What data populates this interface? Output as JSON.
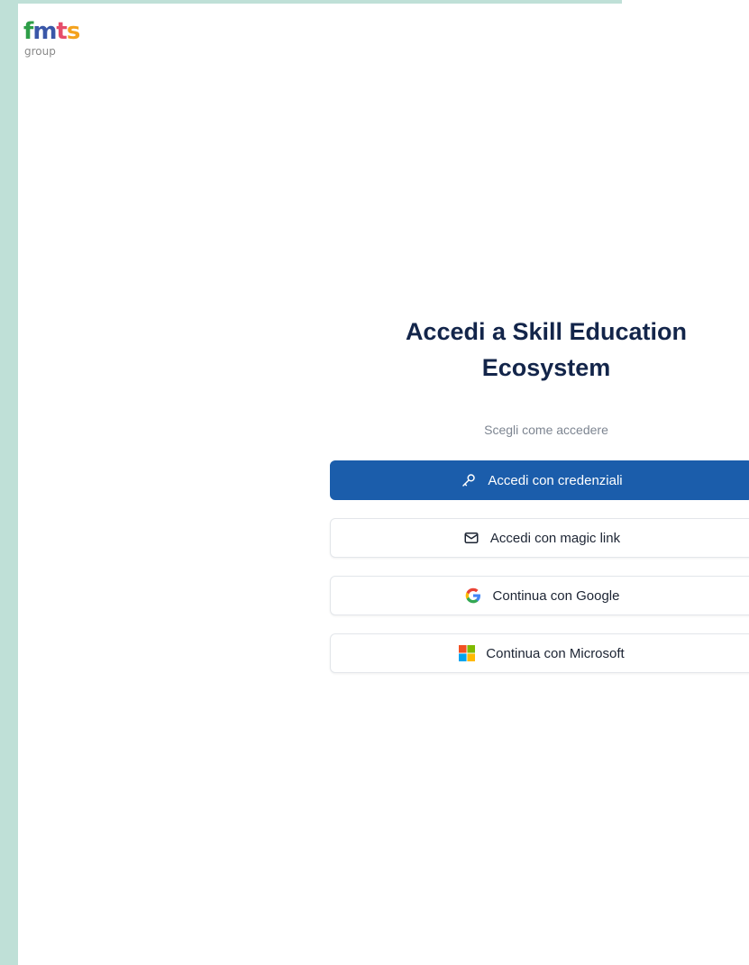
{
  "logo": {
    "letters": [
      "f",
      "m",
      "t",
      "s"
    ],
    "letter_colors": [
      "#2e9e48",
      "#3a57a8",
      "#e64d6a",
      "#f4a21d"
    ],
    "subtext": "group"
  },
  "signin": {
    "title_line1": "Accedi a Skill Education",
    "title_line2": "Ecosystem",
    "subtitle": "Scegli come accedere",
    "buttons": [
      {
        "label": "Accedi con credenziali",
        "icon": "key-icon"
      },
      {
        "label": "Accedi con magic link",
        "icon": "mail-icon"
      },
      {
        "label": "Continua con Google",
        "icon": "google-icon"
      },
      {
        "label": "Continua con Microsoft",
        "icon": "microsoft-icon"
      }
    ]
  },
  "colors": {
    "primary": "#1b5dab",
    "title": "#13254a",
    "background_outer": "#bfe0d7"
  }
}
